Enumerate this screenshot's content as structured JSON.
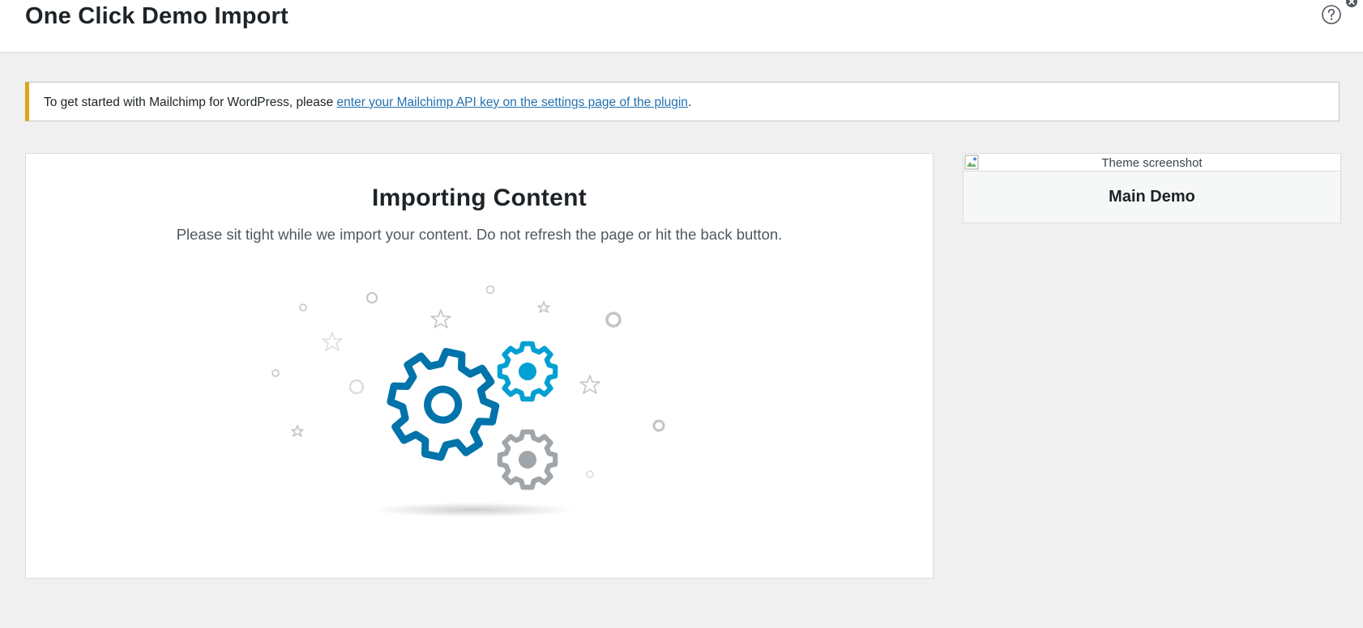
{
  "header": {
    "title": "One Click Demo Import",
    "help_icon": "help-circle-icon",
    "close_icon": "close-icon"
  },
  "notice": {
    "text_before": "To get started with Mailchimp for WordPress, please ",
    "link_text": "enter your Mailchimp API key on the settings page of the plugin",
    "text_after": ".",
    "accent_color": "#dba617",
    "link_color": "#2271b1"
  },
  "importing": {
    "title": "Importing Content",
    "description": "Please sit tight while we import your content. Do not refresh the page or hit the back button.",
    "illustration": "gears-icon",
    "gear_colors": [
      "#0073aa",
      "#00a0d2",
      "#a0a5aa"
    ]
  },
  "demo_card": {
    "screenshot_alt": "Theme screenshot",
    "name": "Main Demo"
  }
}
